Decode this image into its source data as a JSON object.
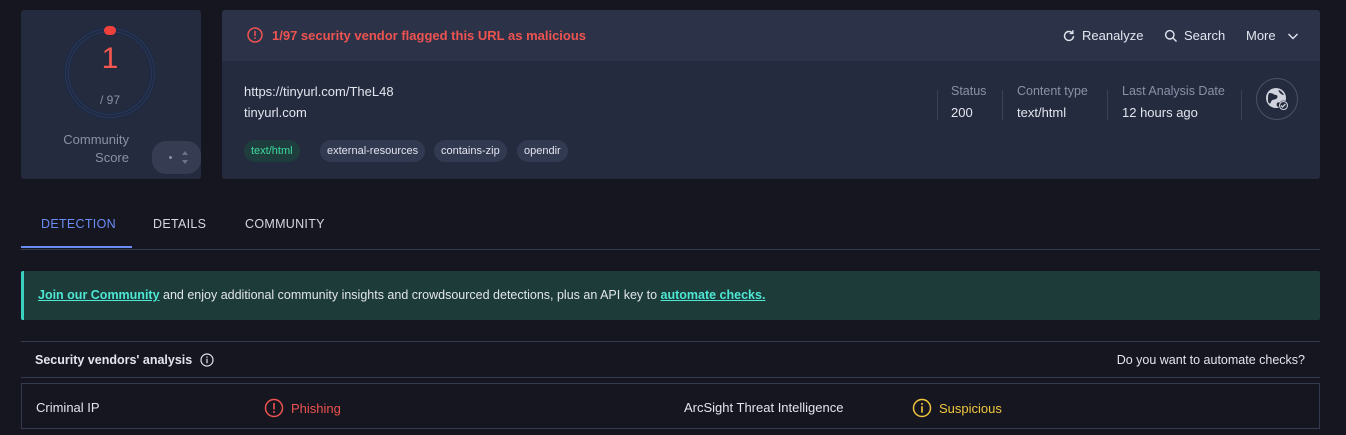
{
  "score": {
    "detections": "1",
    "total": "/ 97",
    "community_label_1": "Community",
    "community_label_2": "Score",
    "gauge_fraction": 0.0103
  },
  "alert": {
    "text": "1/97 security vendor flagged this URL as malicious"
  },
  "actions": {
    "reanalyze": "Reanalyze",
    "search": "Search",
    "more": "More"
  },
  "resource": {
    "url": "https://tinyurl.com/TheL48",
    "domain": "tinyurl.com",
    "tags": [
      "text/html",
      "external-resources",
      "contains-zip",
      "opendir"
    ]
  },
  "meta": {
    "status_label": "Status",
    "status_value": "200",
    "content_type_label": "Content type",
    "content_type_value": "text/html",
    "last_analysis_label": "Last Analysis Date",
    "last_analysis_value": "12 hours ago"
  },
  "tabs": [
    "DETECTION",
    "DETAILS",
    "COMMUNITY"
  ],
  "banner": {
    "link1": "Join our Community",
    "middle": " and enjoy additional community insights and crowdsourced detections, plus an API key to ",
    "link2": "automate checks."
  },
  "vendors": {
    "title": "Security vendors' analysis",
    "automate": "Do you want to automate checks?",
    "rows": [
      {
        "vendor1": "Criminal IP",
        "result1": "Phishing",
        "vendor2": "ArcSight Threat Intelligence",
        "result2": "Suspicious"
      }
    ]
  },
  "colors": {
    "malicious": "#ee5350",
    "suspicious": "#f0c63d",
    "accent": "#6c8cf5",
    "tag_mime": "#3dd9a0",
    "banner_link": "#4ee6d4"
  }
}
